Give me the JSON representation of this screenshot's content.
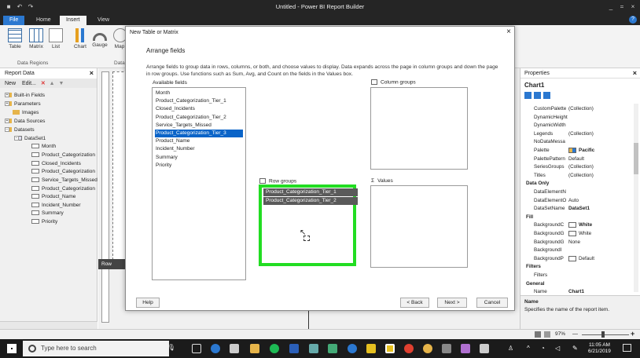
{
  "titlebar": {
    "title": "Untitled - Power BI Report Builder"
  },
  "ribbon_tabs": [
    "File",
    "Home",
    "Insert",
    "View"
  ],
  "ribbon": {
    "buttons": [
      "Table",
      "Matrix",
      "List",
      "Chart",
      "Gauge",
      "Map"
    ],
    "group_label": "Data Regions",
    "group_label_2": "Data"
  },
  "report_data": {
    "title": "Report Data",
    "new": "New",
    "edit": "Edit...",
    "tree": [
      "Built-in Fields",
      "Parameters",
      "Images",
      "Data Sources",
      "Datasets",
      "DataSet1"
    ],
    "fields": [
      "Month",
      "Product_Categorization",
      "Closed_Incidents",
      "Product_Categorization",
      "Service_Targets_Missed",
      "Product_Categorization",
      "Product_Name",
      "Incident_Number",
      "Summary",
      "Priority"
    ]
  },
  "canvas": {
    "row_label": "Row"
  },
  "dialog": {
    "title": "New Table or Matrix",
    "subtitle": "Arrange fields",
    "instructions": "Arrange fields to group data in rows, columns, or both, and choose values to display. Data expands across the page in column groups and down the page in row groups.  Use functions such as Sum, Avg, and Count on the fields in the Values box.",
    "available_label": "Available fields",
    "available_fields": [
      "Month",
      "Product_Categorization_Tier_1",
      "Closed_Incidents",
      "Product_Categorization_Tier_2",
      "Service_Targets_Missed",
      "Product_Categorization_Tier_3",
      "Product_Name",
      "Incident_Number",
      "Summary",
      "Priority"
    ],
    "selected_index": 5,
    "column_groups_label": "Column groups",
    "row_groups_label": "Row groups",
    "row_groups": [
      "Product_Categorization_Tier_1",
      "Product_Categorization_Tier_2"
    ],
    "values_label": "Values",
    "buttons": {
      "help": "Help",
      "back": "< Back",
      "next": "Next >",
      "cancel": "Cancel"
    },
    "highlight_color": "#22dd22"
  },
  "properties": {
    "title": "Properties",
    "object": "Chart1",
    "rows": [
      {
        "n": "CustomPalette",
        "v": "(Collection)"
      },
      {
        "n": "DynamicHeight",
        "v": ""
      },
      {
        "n": "DynamicWidth",
        "v": ""
      },
      {
        "n": "Legends",
        "v": "(Collection)"
      },
      {
        "n": "NoDataMessa",
        "v": ""
      },
      {
        "n": "Palette",
        "v": "Pacific"
      },
      {
        "n": "PalettePattern",
        "v": "Default"
      },
      {
        "n": "SeriesGroups",
        "v": "(Collection)"
      },
      {
        "n": "Titles",
        "v": "(Collection)"
      },
      {
        "n": "Data Only",
        "v": ""
      },
      {
        "n": "DataElementN",
        "v": ""
      },
      {
        "n": "DataElementO",
        "v": "Auto"
      },
      {
        "n": "DataSetName",
        "v": "DataSet1"
      },
      {
        "n": "Fill",
        "v": ""
      },
      {
        "n": "BackgroundC",
        "v": "White"
      },
      {
        "n": "BackgroundG",
        "v": "White"
      },
      {
        "n": "BackgroundG",
        "v": "None"
      },
      {
        "n": "BackgroundI",
        "v": ""
      },
      {
        "n": "BackgroundP",
        "v": "Default"
      },
      {
        "n": "Filters",
        "v": ""
      },
      {
        "n": "Filters",
        "v": ""
      },
      {
        "n": "General",
        "v": ""
      },
      {
        "n": "Name",
        "v": "Chart1"
      }
    ],
    "desc_title": "Name",
    "desc_text": "Specifies the name of the report item."
  },
  "status": {
    "zoom": "97%"
  },
  "taskbar": {
    "search_placeholder": "Type here to search",
    "time": "11:05 AM",
    "date": "6/21/2019"
  }
}
